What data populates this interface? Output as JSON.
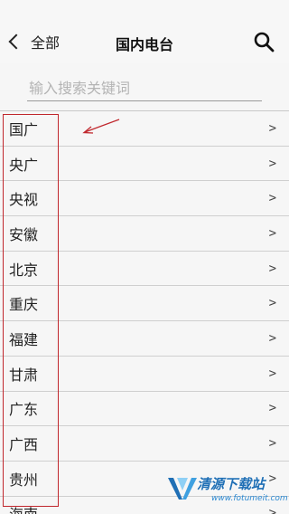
{
  "header": {
    "back_label": "全部",
    "title": "国内电台"
  },
  "search": {
    "placeholder": "输入搜索关键词",
    "value": ""
  },
  "list": {
    "arrow": ">",
    "items": [
      {
        "label": "国广"
      },
      {
        "label": "央广"
      },
      {
        "label": "央视"
      },
      {
        "label": "安徽"
      },
      {
        "label": "北京"
      },
      {
        "label": "重庆"
      },
      {
        "label": "福建"
      },
      {
        "label": "甘肃"
      },
      {
        "label": "广东"
      },
      {
        "label": "广西"
      },
      {
        "label": "贵州"
      },
      {
        "label": "海南"
      }
    ]
  },
  "annotation": {
    "box_color": "#c0272d",
    "arrow_color": "#c0272d"
  },
  "watermark": {
    "name": "清源下载站",
    "url": "www.fotumeit.com"
  },
  "icons": {
    "back": "chevron-left-icon",
    "search": "search-icon",
    "row_arrow": "chevron-right-icon"
  }
}
